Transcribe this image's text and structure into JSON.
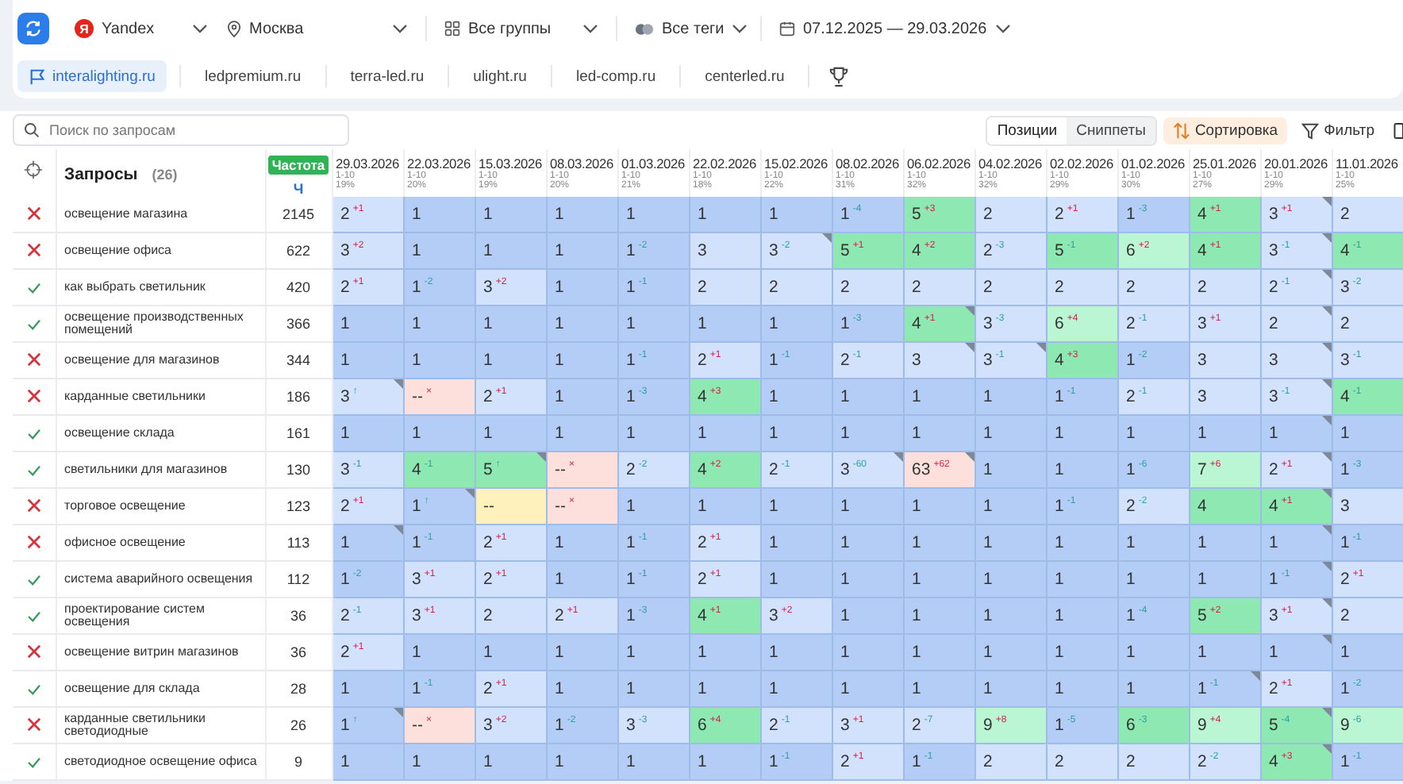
{
  "filters": {
    "engine": {
      "logo": "Я",
      "label": "Yandex"
    },
    "region": "Москва",
    "groups": "Все группы",
    "tags": "Все теги",
    "period": "07.12.2025 — 29.03.2026"
  },
  "sites": [
    {
      "label": "interalighting.ru",
      "selected": true
    },
    {
      "label": "ledpremium.ru",
      "selected": false
    },
    {
      "label": "terra-led.ru",
      "selected": false
    },
    {
      "label": "ulight.ru",
      "selected": false
    },
    {
      "label": "led-comp.ru",
      "selected": false
    },
    {
      "label": "centerled.ru",
      "selected": false
    }
  ],
  "view": {
    "search": {
      "placeholder": "Поиск по запросам"
    },
    "modes": [
      {
        "label": "Позиции",
        "selected": true
      },
      {
        "label": "Сниппеты",
        "selected": false
      }
    ],
    "sort": "Сортировка",
    "filter": "Фильтр"
  },
  "table": {
    "title": "Запросы",
    "count": "(26)",
    "frequency": {
      "badge": "Частота",
      "unit": "Ч"
    },
    "columns": [
      {
        "date": "29.03.2026",
        "range": "1-10",
        "share": "19%"
      },
      {
        "date": "22.03.2026",
        "range": "1-10",
        "share": "20%"
      },
      {
        "date": "15.03.2026",
        "range": "1-10",
        "share": "19%"
      },
      {
        "date": "08.03.2026",
        "range": "1-10",
        "share": "20%"
      },
      {
        "date": "01.03.2026",
        "range": "1-10",
        "share": "21%"
      },
      {
        "date": "22.02.2026",
        "range": "1-10",
        "share": "18%"
      },
      {
        "date": "15.02.2026",
        "range": "1-10",
        "share": "22%"
      },
      {
        "date": "08.02.2026",
        "range": "1-10",
        "share": "31%"
      },
      {
        "date": "06.02.2026",
        "range": "1-10",
        "share": "32%"
      },
      {
        "date": "04.02.2026",
        "range": "1-10",
        "share": "32%"
      },
      {
        "date": "02.02.2026",
        "range": "1-10",
        "share": "29%"
      },
      {
        "date": "01.02.2026",
        "range": "1-10",
        "share": "30%"
      },
      {
        "date": "25.01.2026",
        "range": "1-10",
        "share": "27%"
      },
      {
        "date": "20.01.2026",
        "range": "1-10",
        "share": "29%"
      },
      {
        "date": "11.01.2026",
        "range": "1-10",
        "share": "25%"
      }
    ],
    "rows": [
      {
        "in_top": false,
        "query": "освещение магазина",
        "frequency": "2145",
        "cells": [
          {
            "value": "2",
            "delta": "+1",
            "worse": true,
            "kind": "top3",
            "marked": false
          },
          {
            "value": "1",
            "kind": "top1",
            "marked": false
          },
          {
            "value": "1",
            "kind": "top1",
            "marked": false
          },
          {
            "value": "1",
            "kind": "top1",
            "marked": false
          },
          {
            "value": "1",
            "kind": "top1",
            "marked": false
          },
          {
            "value": "1",
            "kind": "top1",
            "marked": false
          },
          {
            "value": "1",
            "kind": "top1",
            "marked": false
          },
          {
            "value": "1",
            "delta": "-4",
            "worse": false,
            "kind": "top1",
            "marked": false
          },
          {
            "value": "5",
            "delta": "+3",
            "worse": true,
            "kind": "top5",
            "marked": false
          },
          {
            "value": "2",
            "kind": "top3",
            "marked": false
          },
          {
            "value": "2",
            "delta": "+1",
            "worse": true,
            "kind": "top3",
            "marked": false
          },
          {
            "value": "1",
            "delta": "-3",
            "worse": false,
            "kind": "top1",
            "marked": false
          },
          {
            "value": "4",
            "delta": "+1",
            "worse": true,
            "kind": "top5",
            "marked": false
          },
          {
            "value": "3",
            "delta": "+1",
            "worse": true,
            "kind": "top3",
            "marked": true
          },
          {
            "value": "2",
            "kind": "top3",
            "marked": false
          }
        ]
      },
      {
        "in_top": false,
        "query": "освещение офиса",
        "frequency": "622",
        "cells": [
          {
            "value": "3",
            "delta": "+2",
            "worse": true,
            "kind": "top3",
            "marked": false
          },
          {
            "value": "1",
            "kind": "top1",
            "marked": false
          },
          {
            "value": "1",
            "kind": "top1",
            "marked": false
          },
          {
            "value": "1",
            "kind": "top1",
            "marked": false
          },
          {
            "value": "1",
            "delta": "-2",
            "worse": false,
            "kind": "top1",
            "marked": false
          },
          {
            "value": "3",
            "kind": "top3",
            "marked": false
          },
          {
            "value": "3",
            "delta": "-2",
            "worse": false,
            "kind": "top3",
            "marked": true
          },
          {
            "value": "5",
            "delta": "+1",
            "worse": true,
            "kind": "top5",
            "marked": false
          },
          {
            "value": "4",
            "delta": "+2",
            "worse": true,
            "kind": "top5",
            "marked": false
          },
          {
            "value": "2",
            "delta": "-3",
            "worse": false,
            "kind": "top3",
            "marked": false
          },
          {
            "value": "5",
            "delta": "-1",
            "worse": false,
            "kind": "top5",
            "marked": false
          },
          {
            "value": "6",
            "delta": "+2",
            "worse": true,
            "kind": "top10",
            "marked": false
          },
          {
            "value": "4",
            "delta": "+1",
            "worse": true,
            "kind": "top5",
            "marked": false
          },
          {
            "value": "3",
            "delta": "-1",
            "worse": false,
            "kind": "top3",
            "marked": true
          },
          {
            "value": "4",
            "delta": "-1",
            "worse": false,
            "kind": "top5",
            "marked": false
          }
        ]
      },
      {
        "in_top": true,
        "query": "как выбрать светильник",
        "frequency": "420",
        "cells": [
          {
            "value": "2",
            "delta": "+1",
            "worse": true,
            "kind": "top3",
            "marked": false
          },
          {
            "value": "1",
            "delta": "-2",
            "worse": false,
            "kind": "top1",
            "marked": false
          },
          {
            "value": "3",
            "delta": "+2",
            "worse": true,
            "kind": "top3",
            "marked": false
          },
          {
            "value": "1",
            "kind": "top1",
            "marked": false
          },
          {
            "value": "1",
            "delta": "-1",
            "worse": false,
            "kind": "top1",
            "marked": false
          },
          {
            "value": "2",
            "kind": "top3",
            "marked": false
          },
          {
            "value": "2",
            "kind": "top3",
            "marked": false
          },
          {
            "value": "2",
            "kind": "top3",
            "marked": false
          },
          {
            "value": "2",
            "kind": "top3",
            "marked": false
          },
          {
            "value": "2",
            "kind": "top3",
            "marked": false
          },
          {
            "value": "2",
            "kind": "top3",
            "marked": false
          },
          {
            "value": "2",
            "kind": "top3",
            "marked": false
          },
          {
            "value": "2",
            "kind": "top3",
            "marked": false
          },
          {
            "value": "2",
            "delta": "-1",
            "worse": false,
            "kind": "top3",
            "marked": true
          },
          {
            "value": "3",
            "delta": "-2",
            "worse": false,
            "kind": "top3",
            "marked": false
          }
        ]
      },
      {
        "in_top": true,
        "query": "освещение производственных помещений",
        "frequency": "366",
        "cells": [
          {
            "value": "1",
            "kind": "top1",
            "marked": false
          },
          {
            "value": "1",
            "kind": "top1",
            "marked": false
          },
          {
            "value": "1",
            "kind": "top1",
            "marked": false
          },
          {
            "value": "1",
            "kind": "top1",
            "marked": false
          },
          {
            "value": "1",
            "kind": "top1",
            "marked": false
          },
          {
            "value": "1",
            "kind": "top1",
            "marked": false
          },
          {
            "value": "1",
            "kind": "top1",
            "marked": false
          },
          {
            "value": "1",
            "delta": "-3",
            "worse": false,
            "kind": "top1",
            "marked": false
          },
          {
            "value": "4",
            "delta": "+1",
            "worse": true,
            "kind": "top5",
            "marked": true
          },
          {
            "value": "3",
            "delta": "-3",
            "worse": false,
            "kind": "top3",
            "marked": false
          },
          {
            "value": "6",
            "delta": "+4",
            "worse": true,
            "kind": "top10",
            "marked": false
          },
          {
            "value": "2",
            "delta": "-1",
            "worse": false,
            "kind": "top3",
            "marked": false
          },
          {
            "value": "3",
            "delta": "+1",
            "worse": true,
            "kind": "top3",
            "marked": false
          },
          {
            "value": "2",
            "kind": "top3",
            "marked": true
          },
          {
            "value": "2",
            "kind": "top3",
            "marked": false
          }
        ]
      },
      {
        "in_top": false,
        "query": "освещение для магазинов",
        "frequency": "344",
        "cells": [
          {
            "value": "1",
            "kind": "top1",
            "marked": false
          },
          {
            "value": "1",
            "kind": "top1",
            "marked": false
          },
          {
            "value": "1",
            "kind": "top1",
            "marked": false
          },
          {
            "value": "1",
            "kind": "top1",
            "marked": false
          },
          {
            "value": "1",
            "delta": "-1",
            "worse": false,
            "kind": "top1",
            "marked": false
          },
          {
            "value": "2",
            "delta": "+1",
            "worse": true,
            "kind": "top3",
            "marked": false
          },
          {
            "value": "1",
            "delta": "-1",
            "worse": false,
            "kind": "top1",
            "marked": false
          },
          {
            "value": "2",
            "delta": "-1",
            "worse": false,
            "kind": "top3",
            "marked": false
          },
          {
            "value": "3",
            "kind": "top3",
            "marked": true
          },
          {
            "value": "3",
            "delta": "-1",
            "worse": false,
            "kind": "top3",
            "marked": true
          },
          {
            "value": "4",
            "delta": "+3",
            "worse": true,
            "kind": "top5",
            "marked": false
          },
          {
            "value": "1",
            "delta": "-2",
            "worse": false,
            "kind": "top1",
            "marked": false
          },
          {
            "value": "3",
            "kind": "top3",
            "marked": false
          },
          {
            "value": "3",
            "kind": "top3",
            "marked": true
          },
          {
            "value": "3",
            "delta": "-1",
            "worse": false,
            "kind": "top3",
            "marked": false
          }
        ]
      },
      {
        "in_top": false,
        "query": "карданные светильники",
        "frequency": "186",
        "cells": [
          {
            "value": "3",
            "delta": "↑",
            "worse": false,
            "kind": "top3",
            "marked": true
          },
          {
            "value": "--",
            "delta": "×",
            "worse": true,
            "kind": "out",
            "marked": false
          },
          {
            "value": "2",
            "delta": "+1",
            "worse": true,
            "kind": "top3",
            "marked": false
          },
          {
            "value": "1",
            "kind": "top1",
            "marked": false
          },
          {
            "value": "1",
            "delta": "-3",
            "worse": false,
            "kind": "top1",
            "marked": false
          },
          {
            "value": "4",
            "delta": "+3",
            "worse": true,
            "kind": "top5",
            "marked": false
          },
          {
            "value": "1",
            "kind": "top1",
            "marked": false
          },
          {
            "value": "1",
            "kind": "top1",
            "marked": false
          },
          {
            "value": "1",
            "kind": "top1",
            "marked": false
          },
          {
            "value": "1",
            "kind": "top1",
            "marked": false
          },
          {
            "value": "1",
            "delta": "-1",
            "worse": false,
            "kind": "top1",
            "marked": false
          },
          {
            "value": "2",
            "delta": "-1",
            "worse": false,
            "kind": "top3",
            "marked": false
          },
          {
            "value": "3",
            "kind": "top3",
            "marked": false
          },
          {
            "value": "3",
            "delta": "-1",
            "worse": false,
            "kind": "top3",
            "marked": true
          },
          {
            "value": "4",
            "delta": "-1",
            "worse": false,
            "kind": "top5",
            "marked": false
          }
        ]
      },
      {
        "in_top": true,
        "query": "освещение склада",
        "frequency": "161",
        "cells": [
          {
            "value": "1",
            "kind": "top1",
            "marked": false
          },
          {
            "value": "1",
            "kind": "top1",
            "marked": false
          },
          {
            "value": "1",
            "kind": "top1",
            "marked": false
          },
          {
            "value": "1",
            "kind": "top1",
            "marked": false
          },
          {
            "value": "1",
            "kind": "top1",
            "marked": false
          },
          {
            "value": "1",
            "kind": "top1",
            "marked": false
          },
          {
            "value": "1",
            "kind": "top1",
            "marked": false
          },
          {
            "value": "1",
            "kind": "top1",
            "marked": false
          },
          {
            "value": "1",
            "kind": "top1",
            "marked": false
          },
          {
            "value": "1",
            "kind": "top1",
            "marked": false
          },
          {
            "value": "1",
            "kind": "top1",
            "marked": false
          },
          {
            "value": "1",
            "kind": "top1",
            "marked": false
          },
          {
            "value": "1",
            "kind": "top1",
            "marked": false
          },
          {
            "value": "1",
            "kind": "top1",
            "marked": true
          },
          {
            "value": "1",
            "kind": "top1",
            "marked": false
          }
        ]
      },
      {
        "in_top": true,
        "query": "светильники для магазинов",
        "frequency": "130",
        "cells": [
          {
            "value": "3",
            "delta": "-1",
            "worse": false,
            "kind": "top3",
            "marked": false
          },
          {
            "value": "4",
            "delta": "-1",
            "worse": false,
            "kind": "top5",
            "marked": false
          },
          {
            "value": "5",
            "delta": "↑",
            "worse": false,
            "kind": "top5",
            "marked": true
          },
          {
            "value": "--",
            "delta": "×",
            "worse": true,
            "kind": "out",
            "marked": false
          },
          {
            "value": "2",
            "delta": "-2",
            "worse": false,
            "kind": "top3",
            "marked": false
          },
          {
            "value": "4",
            "delta": "+2",
            "worse": true,
            "kind": "top5",
            "marked": false
          },
          {
            "value": "2",
            "delta": "-1",
            "worse": false,
            "kind": "top3",
            "marked": false
          },
          {
            "value": "3",
            "delta": "-60",
            "worse": false,
            "kind": "top3",
            "marked": true
          },
          {
            "value": "63",
            "delta": "+62",
            "worse": true,
            "kind": "out",
            "marked": true
          },
          {
            "value": "1",
            "kind": "top1",
            "marked": false
          },
          {
            "value": "1",
            "kind": "top1",
            "marked": false
          },
          {
            "value": "1",
            "delta": "-6",
            "worse": false,
            "kind": "top1",
            "marked": false
          },
          {
            "value": "7",
            "delta": "+6",
            "worse": true,
            "kind": "top10",
            "marked": false
          },
          {
            "value": "2",
            "delta": "+1",
            "worse": true,
            "kind": "top3",
            "marked": true
          },
          {
            "value": "1",
            "delta": "-3",
            "worse": false,
            "kind": "top1",
            "marked": false
          }
        ]
      },
      {
        "in_top": false,
        "query": "торговое освещение",
        "frequency": "123",
        "cells": [
          {
            "value": "2",
            "delta": "+1",
            "worse": true,
            "kind": "top3",
            "marked": false
          },
          {
            "value": "1",
            "delta": "↑",
            "worse": false,
            "kind": "top1",
            "marked": true
          },
          {
            "value": "--",
            "kind": "none",
            "marked": false
          },
          {
            "value": "--",
            "delta": "×",
            "worse": true,
            "kind": "out",
            "marked": false
          },
          {
            "value": "1",
            "kind": "top1",
            "marked": false
          },
          {
            "value": "1",
            "kind": "top1",
            "marked": false
          },
          {
            "value": "1",
            "kind": "top1",
            "marked": false
          },
          {
            "value": "1",
            "kind": "top1",
            "marked": false
          },
          {
            "value": "1",
            "kind": "top1",
            "marked": false
          },
          {
            "value": "1",
            "kind": "top1",
            "marked": false
          },
          {
            "value": "1",
            "delta": "-1",
            "worse": false,
            "kind": "top1",
            "marked": false
          },
          {
            "value": "2",
            "delta": "-2",
            "worse": false,
            "kind": "top3",
            "marked": false
          },
          {
            "value": "4",
            "kind": "top5",
            "marked": false
          },
          {
            "value": "4",
            "delta": "+1",
            "worse": true,
            "kind": "top5",
            "marked": true
          },
          {
            "value": "3",
            "kind": "top3",
            "marked": false
          }
        ]
      },
      {
        "in_top": false,
        "query": "офисное освещение",
        "frequency": "113",
        "cells": [
          {
            "value": "1",
            "kind": "top1",
            "marked": true
          },
          {
            "value": "1",
            "delta": "-1",
            "worse": false,
            "kind": "top1",
            "marked": false
          },
          {
            "value": "2",
            "delta": "+1",
            "worse": true,
            "kind": "top3",
            "marked": false
          },
          {
            "value": "1",
            "kind": "top1",
            "marked": false
          },
          {
            "value": "1",
            "delta": "-1",
            "worse": false,
            "kind": "top1",
            "marked": false
          },
          {
            "value": "2",
            "delta": "+1",
            "worse": true,
            "kind": "top3",
            "marked": false
          },
          {
            "value": "1",
            "kind": "top1",
            "marked": false
          },
          {
            "value": "1",
            "kind": "top1",
            "marked": false
          },
          {
            "value": "1",
            "kind": "top1",
            "marked": false
          },
          {
            "value": "1",
            "kind": "top1",
            "marked": false
          },
          {
            "value": "1",
            "kind": "top1",
            "marked": false
          },
          {
            "value": "1",
            "kind": "top1",
            "marked": false
          },
          {
            "value": "1",
            "kind": "top1",
            "marked": false
          },
          {
            "value": "1",
            "kind": "top1",
            "marked": true
          },
          {
            "value": "1",
            "delta": "-1",
            "worse": false,
            "kind": "top1",
            "marked": false
          }
        ]
      },
      {
        "in_top": true,
        "query": "система аварийного освещения",
        "frequency": "112",
        "cells": [
          {
            "value": "1",
            "delta": "-2",
            "worse": false,
            "kind": "top1",
            "marked": false
          },
          {
            "value": "3",
            "delta": "+1",
            "worse": true,
            "kind": "top3",
            "marked": false
          },
          {
            "value": "2",
            "delta": "+1",
            "worse": true,
            "kind": "top3",
            "marked": false
          },
          {
            "value": "1",
            "kind": "top1",
            "marked": false
          },
          {
            "value": "1",
            "delta": "-1",
            "worse": false,
            "kind": "top1",
            "marked": false
          },
          {
            "value": "2",
            "delta": "+1",
            "worse": true,
            "kind": "top3",
            "marked": false
          },
          {
            "value": "1",
            "kind": "top1",
            "marked": false
          },
          {
            "value": "1",
            "kind": "top1",
            "marked": false
          },
          {
            "value": "1",
            "kind": "top1",
            "marked": false
          },
          {
            "value": "1",
            "kind": "top1",
            "marked": false
          },
          {
            "value": "1",
            "kind": "top1",
            "marked": false
          },
          {
            "value": "1",
            "kind": "top1",
            "marked": false
          },
          {
            "value": "1",
            "kind": "top1",
            "marked": false
          },
          {
            "value": "1",
            "delta": "-1",
            "worse": false,
            "kind": "top1",
            "marked": true
          },
          {
            "value": "2",
            "delta": "+1",
            "worse": true,
            "kind": "top3",
            "marked": false
          }
        ]
      },
      {
        "in_top": true,
        "query": "проектирование систем освещения",
        "frequency": "36",
        "cells": [
          {
            "value": "2",
            "delta": "-1",
            "worse": false,
            "kind": "top3",
            "marked": false
          },
          {
            "value": "3",
            "delta": "+1",
            "worse": true,
            "kind": "top3",
            "marked": false
          },
          {
            "value": "2",
            "kind": "top3",
            "marked": false
          },
          {
            "value": "2",
            "delta": "+1",
            "worse": true,
            "kind": "top3",
            "marked": false
          },
          {
            "value": "1",
            "delta": "-3",
            "worse": false,
            "kind": "top1",
            "marked": false
          },
          {
            "value": "4",
            "delta": "+1",
            "worse": true,
            "kind": "top5",
            "marked": false
          },
          {
            "value": "3",
            "delta": "+2",
            "worse": true,
            "kind": "top3",
            "marked": false
          },
          {
            "value": "1",
            "kind": "top1",
            "marked": false
          },
          {
            "value": "1",
            "kind": "top1",
            "marked": false
          },
          {
            "value": "1",
            "kind": "top1",
            "marked": false
          },
          {
            "value": "1",
            "kind": "top1",
            "marked": false
          },
          {
            "value": "1",
            "delta": "-4",
            "worse": false,
            "kind": "top1",
            "marked": false
          },
          {
            "value": "5",
            "delta": "+2",
            "worse": true,
            "kind": "top5",
            "marked": false
          },
          {
            "value": "3",
            "delta": "+1",
            "worse": true,
            "kind": "top3",
            "marked": true
          },
          {
            "value": "2",
            "kind": "top3",
            "marked": false
          }
        ]
      },
      {
        "in_top": false,
        "query": "освещение витрин магазинов",
        "frequency": "36",
        "cells": [
          {
            "value": "2",
            "delta": "+1",
            "worse": true,
            "kind": "top3",
            "marked": false
          },
          {
            "value": "1",
            "kind": "top1",
            "marked": false
          },
          {
            "value": "1",
            "kind": "top1",
            "marked": false
          },
          {
            "value": "1",
            "kind": "top1",
            "marked": false
          },
          {
            "value": "1",
            "kind": "top1",
            "marked": false
          },
          {
            "value": "1",
            "kind": "top1",
            "marked": false
          },
          {
            "value": "1",
            "kind": "top1",
            "marked": false
          },
          {
            "value": "1",
            "kind": "top1",
            "marked": false
          },
          {
            "value": "1",
            "kind": "top1",
            "marked": false
          },
          {
            "value": "1",
            "kind": "top1",
            "marked": false
          },
          {
            "value": "1",
            "kind": "top1",
            "marked": false
          },
          {
            "value": "1",
            "kind": "top1",
            "marked": false
          },
          {
            "value": "1",
            "kind": "top1",
            "marked": false
          },
          {
            "value": "1",
            "kind": "top1",
            "marked": true
          },
          {
            "value": "1",
            "kind": "top1",
            "marked": false
          }
        ]
      },
      {
        "in_top": true,
        "query": "освещение для склада",
        "frequency": "28",
        "cells": [
          {
            "value": "1",
            "kind": "top1",
            "marked": false
          },
          {
            "value": "1",
            "delta": "-1",
            "worse": false,
            "kind": "top1",
            "marked": false
          },
          {
            "value": "2",
            "delta": "+1",
            "worse": true,
            "kind": "top3",
            "marked": false
          },
          {
            "value": "1",
            "kind": "top1",
            "marked": false
          },
          {
            "value": "1",
            "kind": "top1",
            "marked": false
          },
          {
            "value": "1",
            "kind": "top1",
            "marked": false
          },
          {
            "value": "1",
            "kind": "top1",
            "marked": false
          },
          {
            "value": "1",
            "kind": "top1",
            "marked": false
          },
          {
            "value": "1",
            "kind": "top1",
            "marked": false
          },
          {
            "value": "1",
            "kind": "top1",
            "marked": false
          },
          {
            "value": "1",
            "kind": "top1",
            "marked": false
          },
          {
            "value": "1",
            "kind": "top1",
            "marked": false
          },
          {
            "value": "1",
            "delta": "-1",
            "worse": false,
            "kind": "top1",
            "marked": true
          },
          {
            "value": "2",
            "delta": "+1",
            "worse": true,
            "kind": "top3",
            "marked": false
          },
          {
            "value": "1",
            "delta": "-2",
            "worse": false,
            "kind": "top1",
            "marked": false
          }
        ]
      },
      {
        "in_top": false,
        "query": "карданные светильники светодиодные",
        "frequency": "26",
        "cells": [
          {
            "value": "1",
            "delta": "↑",
            "worse": false,
            "kind": "top1",
            "marked": true
          },
          {
            "value": "--",
            "delta": "×",
            "worse": true,
            "kind": "out",
            "marked": false
          },
          {
            "value": "3",
            "delta": "+2",
            "worse": true,
            "kind": "top3",
            "marked": false
          },
          {
            "value": "1",
            "delta": "-2",
            "worse": false,
            "kind": "top1",
            "marked": false
          },
          {
            "value": "3",
            "delta": "-3",
            "worse": false,
            "kind": "top3",
            "marked": false
          },
          {
            "value": "6",
            "delta": "+4",
            "worse": true,
            "kind": "top5",
            "marked": false
          },
          {
            "value": "2",
            "delta": "-1",
            "worse": false,
            "kind": "top3",
            "marked": false
          },
          {
            "value": "3",
            "delta": "+1",
            "worse": true,
            "kind": "top3",
            "marked": false
          },
          {
            "value": "2",
            "delta": "-7",
            "worse": false,
            "kind": "top3",
            "marked": false
          },
          {
            "value": "9",
            "delta": "+8",
            "worse": true,
            "kind": "top10",
            "marked": false
          },
          {
            "value": "1",
            "delta": "-5",
            "worse": false,
            "kind": "top1",
            "marked": false
          },
          {
            "value": "6",
            "delta": "-3",
            "worse": false,
            "kind": "top5",
            "marked": false
          },
          {
            "value": "9",
            "delta": "+4",
            "worse": true,
            "kind": "top10",
            "marked": false
          },
          {
            "value": "5",
            "delta": "-4",
            "worse": false,
            "kind": "top5",
            "marked": true
          },
          {
            "value": "9",
            "delta": "-6",
            "worse": false,
            "kind": "top10",
            "marked": false
          }
        ]
      },
      {
        "in_top": true,
        "query": "светодиодное освещение офиса",
        "frequency": "9",
        "cells": [
          {
            "value": "1",
            "kind": "top1",
            "marked": false
          },
          {
            "value": "1",
            "kind": "top1",
            "marked": false
          },
          {
            "value": "1",
            "kind": "top1",
            "marked": false
          },
          {
            "value": "1",
            "kind": "top1",
            "marked": false
          },
          {
            "value": "1",
            "kind": "top1",
            "marked": false
          },
          {
            "value": "1",
            "kind": "top1",
            "marked": false
          },
          {
            "value": "1",
            "delta": "-1",
            "worse": false,
            "kind": "top1",
            "marked": false
          },
          {
            "value": "2",
            "delta": "+1",
            "worse": true,
            "kind": "top3",
            "marked": false
          },
          {
            "value": "1",
            "delta": "-1",
            "worse": false,
            "kind": "top1",
            "marked": false
          },
          {
            "value": "2",
            "kind": "top3",
            "marked": false
          },
          {
            "value": "2",
            "kind": "top3",
            "marked": false
          },
          {
            "value": "2",
            "kind": "top3",
            "marked": false
          },
          {
            "value": "2",
            "delta": "-2",
            "worse": false,
            "kind": "top3",
            "marked": false
          },
          {
            "value": "4",
            "delta": "+3",
            "worse": true,
            "kind": "top5",
            "marked": true
          },
          {
            "value": "1",
            "delta": "-1",
            "worse": false,
            "kind": "top1",
            "marked": false
          }
        ]
      }
    ]
  }
}
